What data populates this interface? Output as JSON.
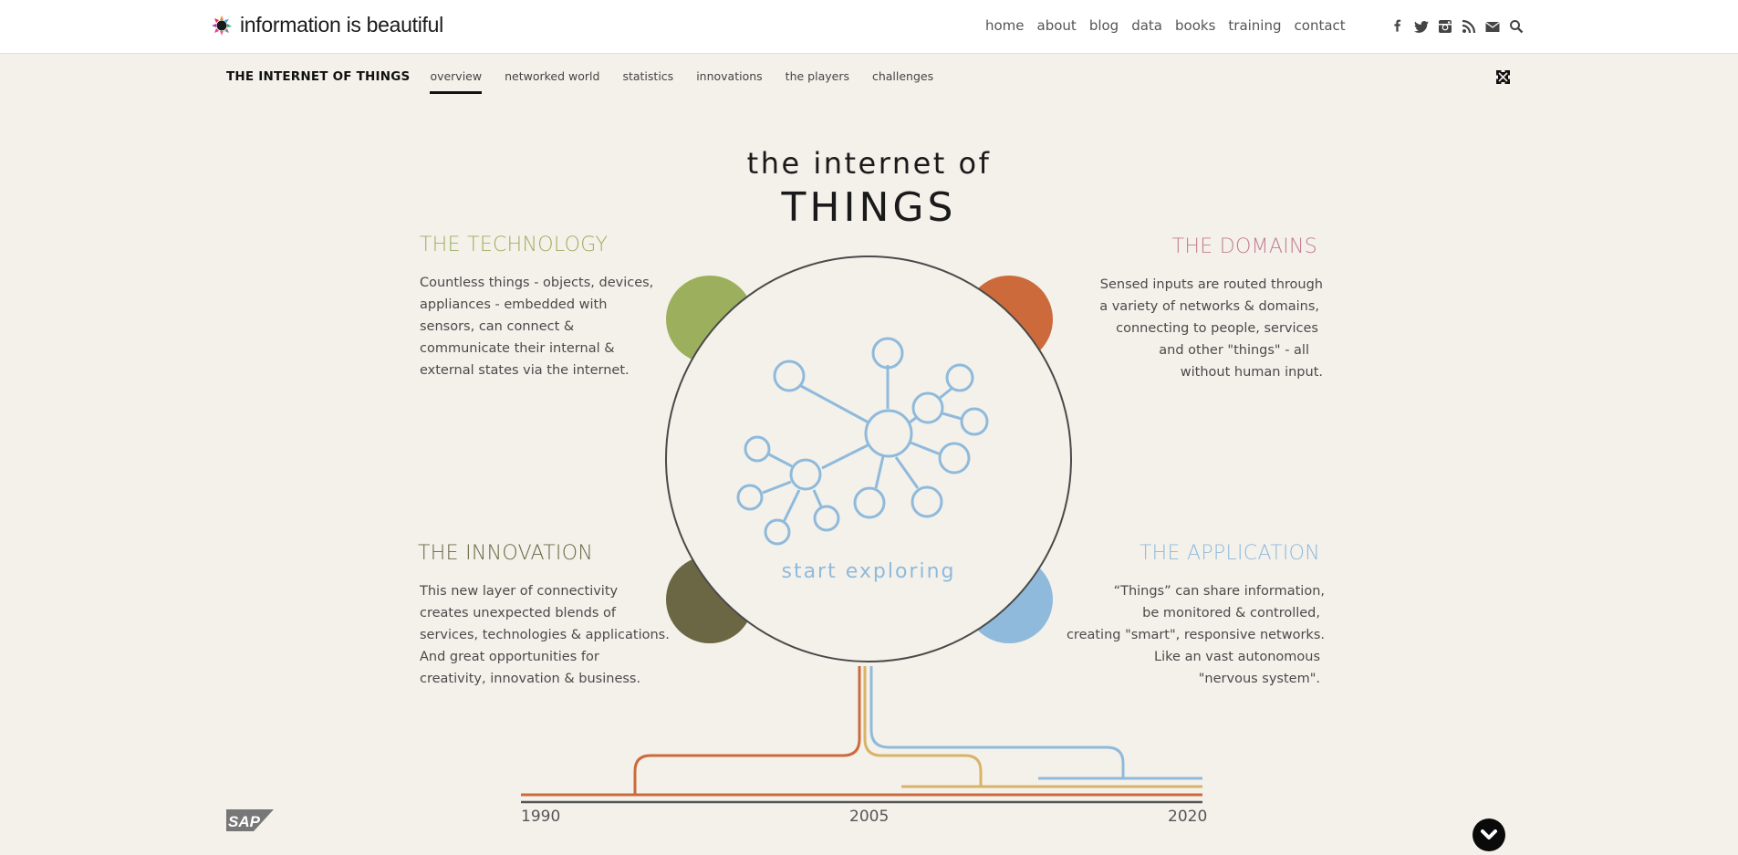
{
  "header": {
    "logo_text": "information is beautiful",
    "nav": [
      "home",
      "about",
      "blog",
      "data",
      "books",
      "training",
      "contact"
    ],
    "social_icons": [
      "facebook-icon",
      "twitter-icon",
      "instagram-icon",
      "rss-icon",
      "email-icon",
      "search-icon"
    ]
  },
  "subnav": {
    "title": "THE INTERNET OF THINGS",
    "tabs": [
      "overview",
      "networked world",
      "statistics",
      "innovations",
      "the players",
      "challenges"
    ],
    "active_tab": "overview"
  },
  "hero": {
    "title_line1": "the internet of",
    "title_line2": "THINGS",
    "cta": "start exploring"
  },
  "sections": {
    "technology": {
      "heading": "THE TECHNOLOGY",
      "color": "#9caf5c",
      "lines": [
        "Countless things - objects, devices,",
        "appliances - embedded with",
        "sensors, can connect &",
        "communicate their internal &",
        "external states via the internet."
      ]
    },
    "domains": {
      "heading": "THE DOMAINS",
      "color": "#c27d93",
      "lines": [
        "Sensed inputs are routed through",
        "a variety of networks & domains,",
        "connecting to people, services",
        "and other \"things\" - all",
        "without human input."
      ]
    },
    "innovation": {
      "heading": "THE INNOVATION",
      "color": "#6b6745",
      "lines": [
        "This new layer of connectivity",
        "creates unexpected blends of",
        "services, technologies & applications.",
        "And great opportunities for",
        "creativity, innovation & business."
      ]
    },
    "application": {
      "heading": "THE APPLICATION",
      "color": "#8fbadb",
      "lines": [
        "“Things” can share information,",
        "be monitored & controlled,",
        "creating \"smart\", responsive networks.",
        "Like an vast autonomous",
        "\"nervous system\"."
      ]
    }
  },
  "colors": {
    "green": "#9caf5c",
    "orange": "#cc6a3b",
    "olive": "#6b6745",
    "blue": "#8fbadb",
    "gold": "#d9b36a",
    "background": "#f4f1eb"
  },
  "timeline": {
    "labels": [
      "1990",
      "2005",
      "2020"
    ]
  },
  "footer": {
    "sponsor": "SAP"
  }
}
